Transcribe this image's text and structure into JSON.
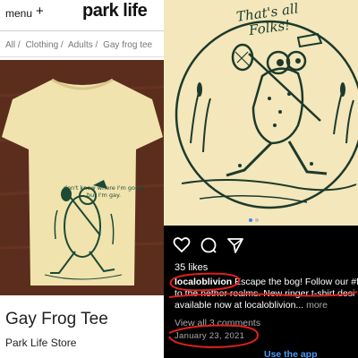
{
  "store_page": {
    "header": {
      "menu_label": "menu",
      "menu_plus": "+",
      "logo": "park life"
    },
    "breadcrumbs": [
      "All /",
      "Clothing /",
      "Adults /",
      "Gay frog tee"
    ],
    "shirt_print_text": "don't know where I'm going but I'm gay.",
    "product_title": "Gay Frog Tee",
    "store_name": "Park Life Store"
  },
  "instagram_post": {
    "image_script_text": "That's all Folks!",
    "likes": "35 likes",
    "username": "localoblivion",
    "caption_line1": " Escape the bog! Follow our #fr",
    "caption_line2": "to the nether realms. New ringer t-shirt desi",
    "caption_line3": "available now at localoblivion...",
    "more_label": " more",
    "view_comments": "View all 3 comments",
    "date": "January 23, 2021",
    "use_app": "Use the app"
  },
  "colors": {
    "shirt": "#f1e3ad",
    "ink": "#1c4a36",
    "photo_bg": "#5e2f1e",
    "annotation_red": "#e0201c",
    "link_blue": "#4a9af8"
  }
}
